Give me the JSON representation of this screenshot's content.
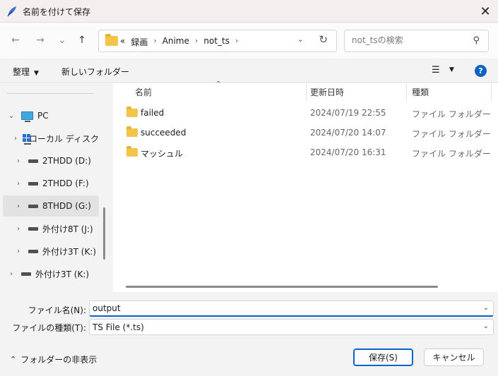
{
  "window": {
    "title": "名前を付けて保存",
    "close_glyph": "✕"
  },
  "nav": {
    "back": "←",
    "forward": "→",
    "recent": "⌄",
    "up": "↑",
    "breadcrumb": [
      "«",
      "録画",
      "Anime",
      "not_ts"
    ],
    "search_placeholder": "not_tsの検索"
  },
  "toolbar": {
    "organize": "整理",
    "new_folder": "新しいフォルダー",
    "help": "?"
  },
  "sidebar": {
    "items": [
      {
        "label": "PC",
        "icon": "pc-icon",
        "expanded": true
      },
      {
        "label": "ローカル ディスク",
        "icon": "local-disk-icon"
      },
      {
        "label": "2THDD (D:)",
        "icon": "drive-icon"
      },
      {
        "label": "2THDD (F:)",
        "icon": "drive-icon"
      },
      {
        "label": "8THDD (G:)",
        "icon": "drive-icon",
        "selected": true
      },
      {
        "label": "外付け8T (J:)",
        "icon": "drive-icon"
      },
      {
        "label": "外付け3T (K:)",
        "icon": "drive-icon"
      },
      {
        "label": "外付け3T (K:)",
        "icon": "drive-icon"
      }
    ]
  },
  "files": {
    "columns": {
      "name": "名前",
      "date": "更新日時",
      "type": "種類"
    },
    "rows": [
      {
        "name": "failed",
        "date": "2024/07/19 22:55",
        "type": "ファイル フォルダー"
      },
      {
        "name": "succeeded",
        "date": "2024/07/20 14:07",
        "type": "ファイル フォルダー"
      },
      {
        "name": "マッシュル",
        "date": "2024/07/20 16:31",
        "type": "ファイル フォルダー"
      }
    ]
  },
  "footer": {
    "filename_label": "ファイル名(N):",
    "filename_value": "output",
    "filetype_label": "ファイルの種類(T):",
    "filetype_value": "TS File (*.ts)",
    "hide_folders": "フォルダーの非表示",
    "save": "保存(S)",
    "cancel": "キャンセル"
  },
  "colors": {
    "accent": "#0a64c8",
    "folder": "#f2c54a"
  }
}
